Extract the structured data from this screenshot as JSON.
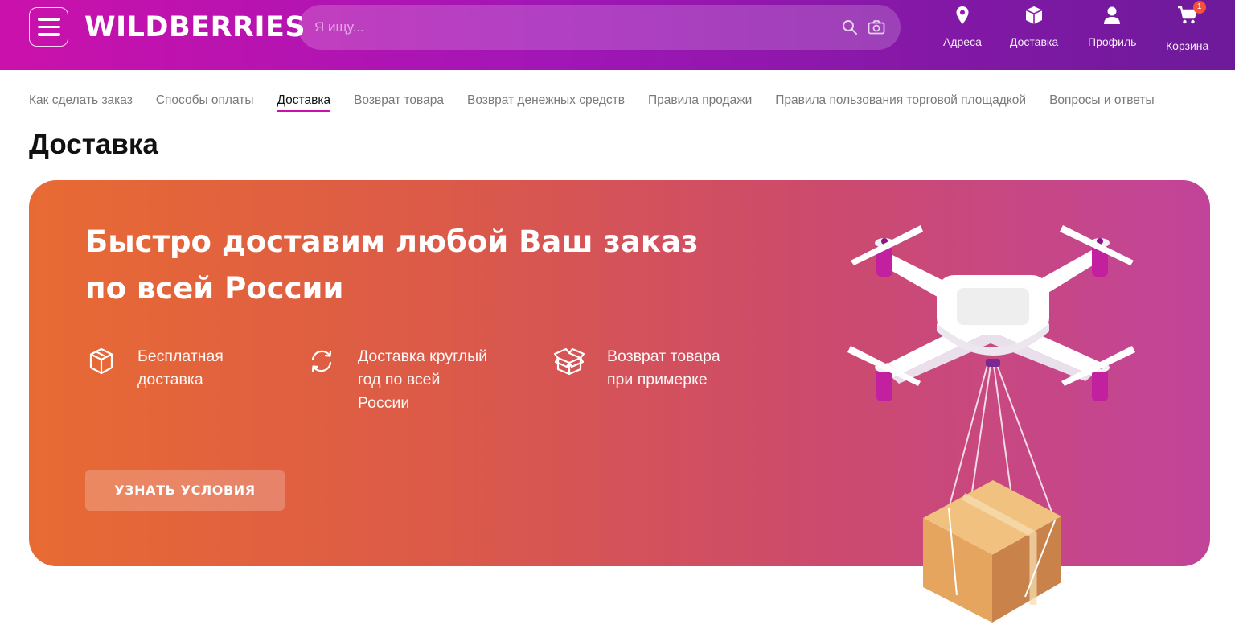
{
  "header": {
    "logo": "WILDBERRIES",
    "search_placeholder": "Я ищу...",
    "nav": [
      {
        "label": "Адреса",
        "icon": "location-pin-icon"
      },
      {
        "label": "Доставка",
        "icon": "box-icon"
      },
      {
        "label": "Профиль",
        "icon": "user-icon"
      },
      {
        "label": "Корзина",
        "icon": "cart-icon",
        "badge": "1"
      }
    ]
  },
  "subnav": {
    "items": [
      "Как сделать заказ",
      "Способы оплаты",
      "Доставка",
      "Возврат товара",
      "Возврат денежных средств",
      "Правила продажи",
      "Правила пользования торговой площадкой",
      "Вопросы и ответы"
    ],
    "active_index": 2
  },
  "page_title": "Доставка",
  "banner": {
    "title_line1": "Быстро доставим любой Ваш заказ",
    "title_line2": "по всей России",
    "features": [
      {
        "icon": "box-icon",
        "line1": "Бесплатная",
        "line2": "доставка",
        "line3": ""
      },
      {
        "icon": "refresh-icon",
        "line1": "Доставка круглый",
        "line2": "год по всей",
        "line3": "России"
      },
      {
        "icon": "open-box-icon",
        "line1": "Возврат товара",
        "line2": "при примерке",
        "line3": ""
      }
    ],
    "cta_label": "УЗНАТЬ УСЛОВИЯ"
  },
  "colors": {
    "brand": "#cb11ab",
    "header_end": "#6d1a9a",
    "banner_start": "#e86a33",
    "banner_end": "#c2449a",
    "badge": "#f5513b"
  }
}
